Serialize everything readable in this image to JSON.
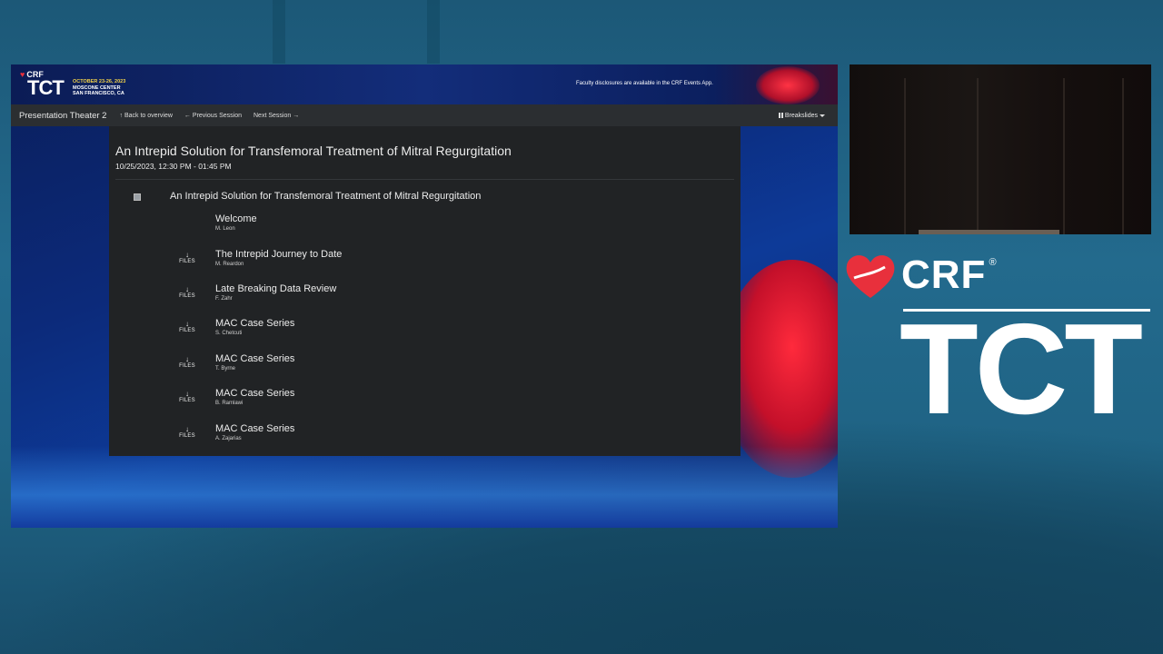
{
  "banner": {
    "crf_label": "CRF",
    "tct_label": "TCT",
    "event_dates": "OCTOBER 23-26, 2023",
    "venue": "MOSCONE CENTER",
    "city": "SAN FRANCISCO, CA",
    "disclosure": "Faculty disclosures are available in the CRF Events App."
  },
  "navbar": {
    "brand": "Presentation Theater 2",
    "back": "Back to overview",
    "previous": "Previous Session",
    "next": "Next Session",
    "breakslides": "Breakslides"
  },
  "session": {
    "title": "An Intrepid Solution for Transfemoral Treatment of Mitral Regurgitation",
    "datetime": "10/25/2023, 12:30 PM - 01:45 PM",
    "group_title": "An Intrepid Solution for Transfemoral Treatment of Mitral Regurgitation"
  },
  "talks": [
    {
      "title": "Welcome",
      "speaker": "M. Leon",
      "has_files": false
    },
    {
      "title": "The Intrepid Journey to Date",
      "speaker": "M. Reardon",
      "has_files": true
    },
    {
      "title": "Late Breaking Data Review",
      "speaker": "F. Zahr",
      "has_files": true
    },
    {
      "title": "MAC Case Series",
      "speaker": "S. Chetcuti",
      "has_files": true
    },
    {
      "title": "MAC Case Series",
      "speaker": "T. Byrne",
      "has_files": true
    },
    {
      "title": "MAC Case Series",
      "speaker": "B. Ramlawi",
      "has_files": true
    },
    {
      "title": "MAC Case Series",
      "speaker": "A. Zajarias",
      "has_files": true
    }
  ],
  "files_label": "FILES",
  "brand_side": {
    "crf": "CRF",
    "reg": "®",
    "tct": "TCT"
  },
  "colors": {
    "background": "#236a8d",
    "panel": "#212325",
    "navbar": "#2b2e31",
    "brand_red": "#e8303c",
    "accent_yellow": "#f2d24a"
  }
}
